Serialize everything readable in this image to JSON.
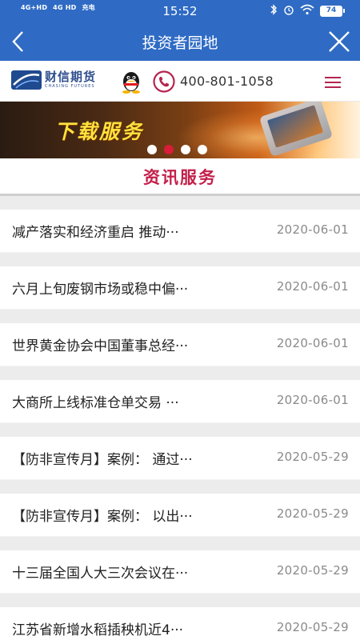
{
  "status_bar": {
    "sim1": "4G+HD",
    "sim2": "4G HD",
    "sim_tag": "充电",
    "time": "15:52",
    "battery": "74"
  },
  "navbar": {
    "title": "投资者园地"
  },
  "brand": {
    "logo_cn": "财信期货",
    "logo_en": "CHASING FUTURES",
    "phone": "400-801-1058"
  },
  "banner": {
    "text": "下载服务",
    "slide_count": 4,
    "active_slide": 1
  },
  "section": {
    "title": "资讯服务"
  },
  "news": [
    {
      "title": "减产落实和经济重启 推动···",
      "date": "2020-06-01"
    },
    {
      "title": "六月上旬废钢市场或稳中偏···",
      "date": "2020-06-01"
    },
    {
      "title": "世界黄金协会中国董事总经···",
      "date": "2020-06-01"
    },
    {
      "title": "大商所上线标准仓单交易 ···",
      "date": "2020-06-01"
    },
    {
      "title": "【防非宣传月】案例： 通过···",
      "date": "2020-05-29"
    },
    {
      "title": "【防非宣传月】案例： 以出···",
      "date": "2020-05-29"
    },
    {
      "title": "十三届全国人大三次会议在···",
      "date": "2020-05-29"
    },
    {
      "title": "江苏省新增水稻插秧机近4···",
      "date": "2020-05-29"
    }
  ],
  "colors": {
    "primary": "#2f6bc4",
    "accent": "#c4204a",
    "active_dot": "#d81c3a"
  }
}
